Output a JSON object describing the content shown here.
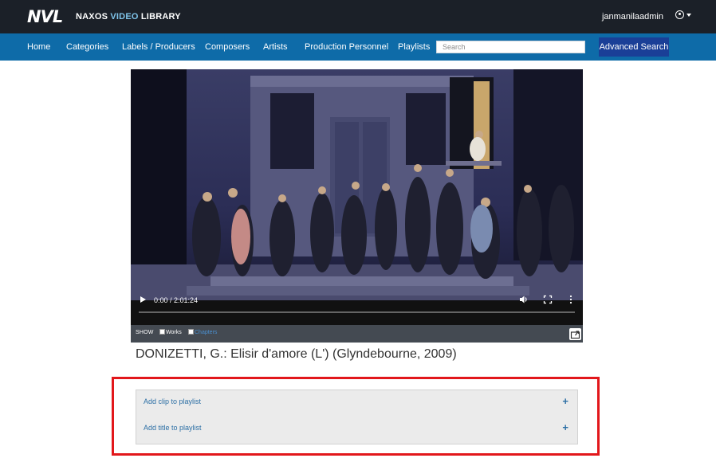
{
  "header": {
    "logo_text": "NVL",
    "brand_prefix": "NAXOS",
    "brand_accent": "VIDEO",
    "brand_suffix": "LIBRARY",
    "username": "janmanilaadmin",
    "user_icon": "user-circle-icon"
  },
  "nav": {
    "items": [
      "Home",
      "Categories",
      "Labels / Producers",
      "Composers",
      "Artists",
      "Production Personnel",
      "Playlists"
    ],
    "search_placeholder": "Search",
    "advanced_search": "Advanced Search"
  },
  "player": {
    "time": "0:00 / 2:01:24",
    "progress": 0,
    "show_label": "SHOW",
    "works_label": "Works",
    "chapters_label": "Chapters",
    "icons": [
      "play-icon",
      "volume-icon",
      "fullscreen-icon",
      "more-icon",
      "export-icon"
    ]
  },
  "title": "DONIZETTI, G.: Elisir d'amore (L') (Glyndebourne, 2009)",
  "playlist_panel": {
    "rows": [
      {
        "label": "Add clip to playlist"
      },
      {
        "label": "Add title to playlist"
      }
    ],
    "plus": "+"
  },
  "colors": {
    "topbar": "#1b2028",
    "navbar": "#0e6ba8",
    "accent_button": "#1a3f97",
    "highlight_border": "#e2171b",
    "link": "#2c6fa5"
  }
}
